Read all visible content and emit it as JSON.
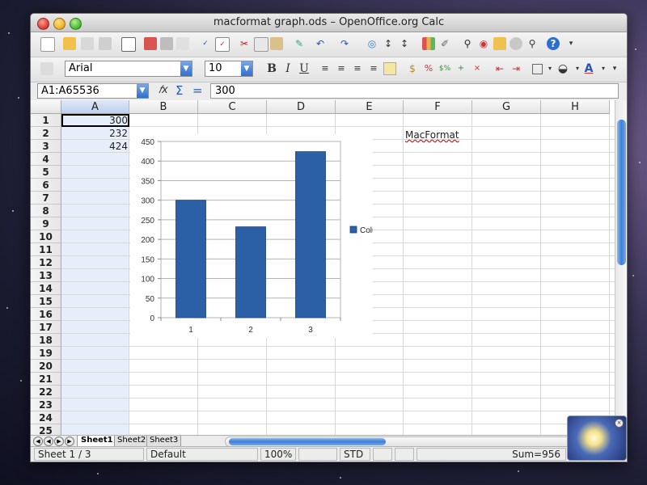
{
  "window": {
    "title": "macformat graph.ods – OpenOffice.org Calc"
  },
  "format_toolbar": {
    "font_name": "Arial",
    "font_size": "10"
  },
  "formula_bar": {
    "name_box": "A1:A65536",
    "function_wizard_glyph": "𝑓x",
    "sum_glyph": "Σ",
    "equals_glyph": "=",
    "input_value": "300"
  },
  "columns": [
    "A",
    "B",
    "C",
    "D",
    "E",
    "F",
    "G",
    "H"
  ],
  "rows": [
    "1",
    "2",
    "3",
    "4",
    "5",
    "6",
    "7",
    "8",
    "9",
    "10",
    "11",
    "12",
    "13",
    "14",
    "15",
    "16",
    "17",
    "18",
    "19",
    "20",
    "21",
    "22",
    "23",
    "24",
    "25"
  ],
  "cells": {
    "A1": "300",
    "A2": "232",
    "A3": "424",
    "F2": "MacFormat"
  },
  "chart_data": {
    "type": "bar",
    "categories": [
      "1",
      "2",
      "3"
    ],
    "series": [
      {
        "name": "Column A",
        "values": [
          300,
          232,
          424
        ]
      }
    ],
    "yticks": [
      "0",
      "50",
      "100",
      "150",
      "200",
      "250",
      "300",
      "350",
      "400",
      "450"
    ],
    "ylim": [
      0,
      450
    ],
    "grid": true,
    "legend": "right",
    "bar_color": "#2b5fa6"
  },
  "sheet_tabs": [
    "Sheet1",
    "Sheet2",
    "Sheet3"
  ],
  "statusbar": {
    "sheet": "Sheet 1 / 3",
    "page_style": "Default",
    "zoom": "100%",
    "mode": "STD",
    "sum": "Sum=956"
  },
  "colors": {
    "accent": "#3d7fd8",
    "selected_column": "#e6eefb",
    "spellcheck_underline": "#d02020"
  }
}
